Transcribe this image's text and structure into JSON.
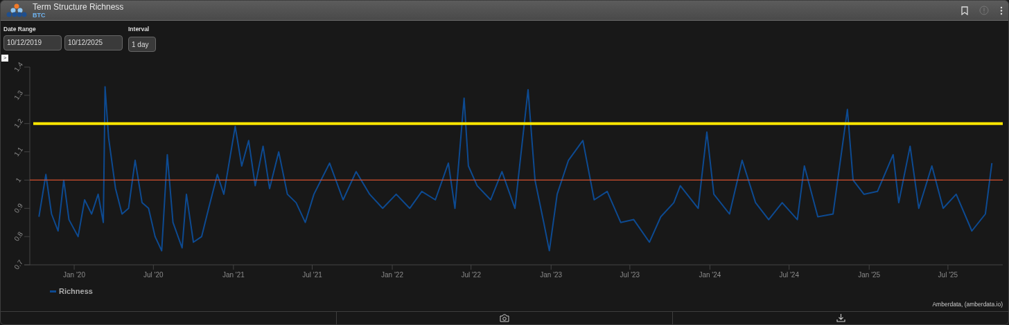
{
  "window": {
    "title": "Term Structure Richness",
    "subtitle": "BTC"
  },
  "filters": {
    "date_range": {
      "label": "Date Range",
      "start": "10/12/2019",
      "end": "10/12/2025"
    },
    "interval": {
      "label": "Interval",
      "value": "1 day"
    }
  },
  "chart": {
    "chart_data": {
      "type": "line",
      "ylim": [
        0.7,
        1.4
      ],
      "yticks": [
        0.7,
        0.8,
        0.9,
        1,
        1.1,
        1.2,
        1.3,
        1.4
      ],
      "xticks": [
        {
          "value": "2020-01-01",
          "label": "Jan '20"
        },
        {
          "value": "2020-07-01",
          "label": "Jul '20"
        },
        {
          "value": "2021-01-01",
          "label": "Jan '21"
        },
        {
          "value": "2021-07-01",
          "label": "Jul '21"
        },
        {
          "value": "2022-01-01",
          "label": "Jan '22"
        },
        {
          "value": "2022-07-01",
          "label": "Jul '22"
        },
        {
          "value": "2023-01-01",
          "label": "Jan '23"
        },
        {
          "value": "2023-07-01",
          "label": "Jul '23"
        },
        {
          "value": "2024-01-01",
          "label": "Jan '24"
        },
        {
          "value": "2024-07-01",
          "label": "Jul '24"
        },
        {
          "value": "2025-01-01",
          "label": "Jan '25"
        },
        {
          "value": "2025-07-01",
          "label": "Jul '25"
        }
      ],
      "x": [
        "2019-10-12",
        "2019-10-28",
        "2019-11-10",
        "2019-11-25",
        "2019-12-08",
        "2019-12-20",
        "2020-01-10",
        "2020-01-25",
        "2020-02-10",
        "2020-02-25",
        "2020-03-08",
        "2020-03-12",
        "2020-03-20",
        "2020-04-05",
        "2020-04-20",
        "2020-05-05",
        "2020-05-20",
        "2020-06-05",
        "2020-06-20",
        "2020-07-05",
        "2020-07-20",
        "2020-08-02",
        "2020-08-15",
        "2020-09-05",
        "2020-09-15",
        "2020-10-01",
        "2020-10-20",
        "2020-11-05",
        "2020-11-25",
        "2020-12-10",
        "2021-01-05",
        "2021-01-20",
        "2021-02-05",
        "2021-02-20",
        "2021-03-10",
        "2021-03-25",
        "2021-04-15",
        "2021-05-05",
        "2021-05-25",
        "2021-06-15",
        "2021-07-05",
        "2021-08-10",
        "2021-09-10",
        "2021-10-10",
        "2021-11-10",
        "2021-12-10",
        "2022-01-10",
        "2022-02-10",
        "2022-03-10",
        "2022-04-10",
        "2022-05-10",
        "2022-05-25",
        "2022-06-15",
        "2022-06-25",
        "2022-07-15",
        "2022-08-15",
        "2022-09-10",
        "2022-10-10",
        "2022-11-09",
        "2022-11-25",
        "2022-12-15",
        "2022-12-28",
        "2023-01-15",
        "2023-02-10",
        "2023-03-15",
        "2023-04-10",
        "2023-05-10",
        "2023-06-10",
        "2023-07-10",
        "2023-08-15",
        "2023-09-10",
        "2023-10-10",
        "2023-10-25",
        "2023-12-05",
        "2023-12-25",
        "2024-01-10",
        "2024-02-15",
        "2024-03-15",
        "2024-04-15",
        "2024-05-15",
        "2024-06-15",
        "2024-07-20",
        "2024-08-05",
        "2024-09-05",
        "2024-10-10",
        "2024-11-12",
        "2024-11-25",
        "2024-12-20",
        "2025-01-20",
        "2025-02-25",
        "2025-03-10",
        "2025-04-05",
        "2025-04-25",
        "2025-05-25",
        "2025-06-20",
        "2025-07-20",
        "2025-08-25",
        "2025-09-25",
        "2025-10-10"
      ],
      "series": [
        {
          "name": "Richness",
          "color": "#0d4a91",
          "values": [
            0.87,
            1.02,
            0.88,
            0.82,
            1.0,
            0.86,
            0.8,
            0.93,
            0.88,
            0.95,
            0.85,
            1.33,
            1.15,
            0.97,
            0.88,
            0.9,
            1.07,
            0.92,
            0.9,
            0.8,
            0.75,
            1.09,
            0.85,
            0.76,
            0.95,
            0.78,
            0.8,
            0.9,
            1.02,
            0.95,
            1.19,
            1.05,
            1.14,
            0.98,
            1.12,
            0.97,
            1.1,
            0.95,
            0.92,
            0.85,
            0.95,
            1.06,
            0.93,
            1.03,
            0.95,
            0.9,
            0.95,
            0.9,
            0.96,
            0.93,
            1.06,
            0.9,
            1.29,
            1.05,
            0.98,
            0.93,
            1.03,
            0.9,
            1.32,
            1.0,
            0.85,
            0.75,
            0.95,
            1.07,
            1.14,
            0.93,
            0.96,
            0.85,
            0.86,
            0.78,
            0.87,
            0.92,
            0.98,
            0.9,
            1.17,
            0.95,
            0.88,
            1.07,
            0.92,
            0.86,
            0.92,
            0.86,
            1.05,
            0.87,
            0.88,
            1.25,
            1.0,
            0.95,
            0.96,
            1.09,
            0.92,
            1.12,
            0.9,
            1.05,
            0.9,
            0.95,
            0.82,
            0.88,
            1.06
          ]
        }
      ],
      "ref_lines": [
        {
          "axis": "y",
          "value": 1.2,
          "color": "#ffe600"
        },
        {
          "axis": "y",
          "value": 1,
          "color": "#d2502d"
        }
      ],
      "xlim": [
        "2019-09-21",
        "2025-11-04"
      ]
    }
  },
  "expander": ">",
  "credit": "Amberdata, (amberdata.io)"
}
